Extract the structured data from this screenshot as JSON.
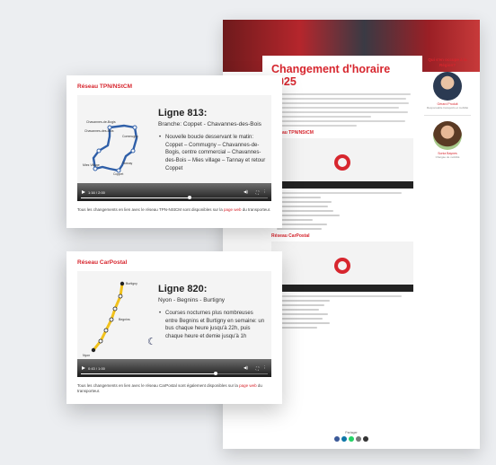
{
  "background_page": {
    "title": "Changement d'horaire 2025",
    "section_tpn": "Réseau TPN/NStCM",
    "section_carpostal": "Réseau CarPostal",
    "sidebar": {
      "question": "Qui s'en occupe à la Région?",
      "person1": {
        "name": "Gérard Produit",
        "role": "Responsable transports et mobilité"
      },
      "person2": {
        "name": "Sonia Baynes",
        "role": "Chargée de mobilité"
      }
    },
    "footer_label": "Partager"
  },
  "card_tpn": {
    "header": "Réseau TPN/NStCM",
    "line_title": "Ligne 813:",
    "line_subtitle": "Branche: Coppet - Chavannes-des-Bois",
    "bullet": "Nouvelle boucle desservant le matin: Coppet – Commugny – Chavannes-de-Bogis, centre commercial – Chavannes-des-Bois – Mies village – Tannay et retour Coppet",
    "video_time": "1:16 / 2:00",
    "video_progress": 0.58,
    "map_labels": [
      "Chavannes-de-Bogis",
      "Chavannes-des-Bois",
      "Commugny",
      "Mies Village",
      "Tannay",
      "Coppet"
    ],
    "caption_before": "Tous les changements en lien avec le réseau TPN-NStCM sont disponibles sur la ",
    "caption_link": "page web",
    "caption_after": " du transporteur."
  },
  "card_carpostal": {
    "header": "Réseau CarPostal",
    "line_title": "Ligne 820:",
    "line_subtitle": "Nyon - Begnins - Burtigny",
    "bullet": "Courses nocturnes plus nombreuses entre Begnins et Burtigny en semaine: un bus chaque heure jusqu'à 22h, puis chaque heure et demie jusqu'à 1h",
    "video_time": "0:43 / 1:00",
    "video_progress": 0.72,
    "map_labels": [
      "Burtigny",
      "Begnins",
      "Nyon"
    ],
    "caption_before": "Tous les changements en lien avec le réseau CarPostal sont également disponibles sur la ",
    "caption_link": "page web",
    "caption_after": " du transporteur."
  },
  "colors": {
    "accent": "#d7262e",
    "route_blue": "#2f5fa8",
    "route_yellow": "#f2c21b"
  }
}
